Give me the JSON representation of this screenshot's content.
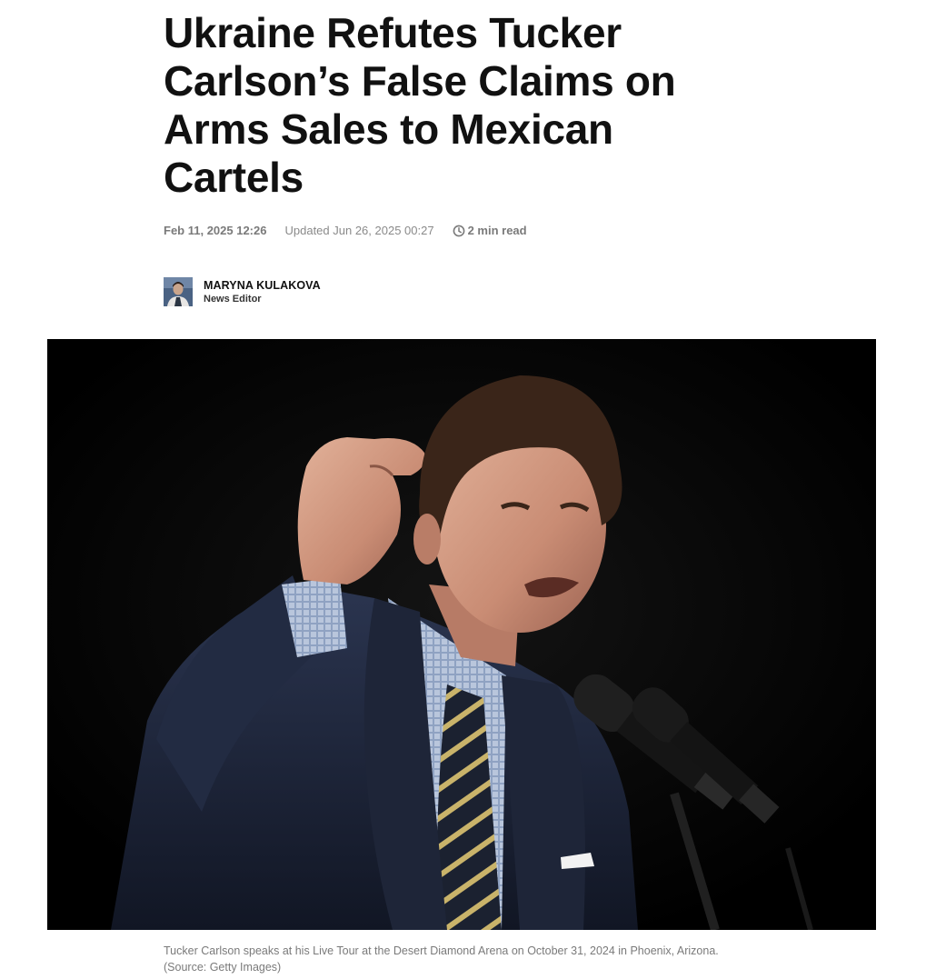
{
  "article": {
    "headline_lines": [
      "Ukraine Refutes Tucker",
      "Carlson’s False Claims on",
      "Arms Sales to Mexican",
      "Cartels"
    ],
    "published": "Feb 11, 2025 12:26",
    "updated": "Updated Jun 26, 2025 00:27",
    "read_time": "2 min read",
    "read_time_icon": "clock-icon"
  },
  "author": {
    "name": "MARYNA KULAKOVA",
    "role": "News Editor"
  },
  "hero_image": {
    "subject": "speaker-at-microphones-photo"
  },
  "caption": {
    "text": "Tucker Carlson speaks at his Live Tour at the Desert Diamond Arena on October 31, 2024 in Phoenix, Arizona.",
    "source": "(Source: Getty Images)"
  },
  "colors": {
    "headline": "#111111",
    "meta": "#7a7a7a",
    "caption": "#7a7a7a",
    "image_background": "#000000"
  }
}
